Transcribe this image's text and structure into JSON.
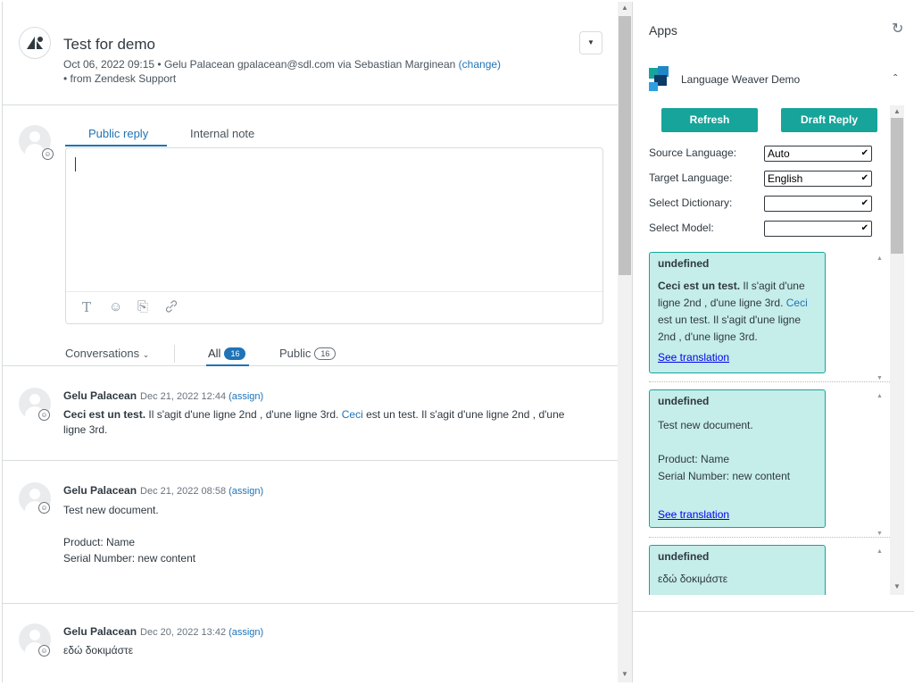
{
  "ticket": {
    "title": "Test for demo",
    "meta_line1_prefix": "Oct 06, 2022 09:15 • Gelu Palacean   gpalacean@sdl.com via Sebastian Marginean ",
    "meta_change": "(change)",
    "meta_line2": "• from Zendesk Support"
  },
  "composer": {
    "tab_public": "Public reply",
    "tab_internal": "Internal note",
    "tools": {
      "text": "T",
      "emoji": "☺",
      "attach": "⎘",
      "link": "🔗"
    }
  },
  "filters": {
    "conversations": "Conversations",
    "all": "All",
    "all_count": "16",
    "public": "Public",
    "public_count": "16"
  },
  "messages": [
    {
      "author": "Gelu Palacean",
      "date": "Dec 21, 2022 12:44",
      "assign": "(assign)",
      "body_bold": "Ceci est un test.",
      "body_rest": "  Il s'agit d'une ligne 2nd , d'une ligne 3rd. ",
      "body_link": "Ceci",
      "body_tail": " est un test. Il s'agit d'une ligne 2nd , d'une ligne 3rd."
    },
    {
      "author": "Gelu Palacean",
      "date": "Dec 21, 2022 08:58",
      "assign": "(assign)",
      "body": "Test new document.\n\nProduct: Name\nSerial Number: new content"
    },
    {
      "author": "Gelu Palacean",
      "date": "Dec 20, 2022 13:42",
      "assign": "(assign)",
      "body": "εδώ δοκιμάστε"
    }
  ],
  "apps": {
    "title": "Apps",
    "app_name": "Language Weaver Demo",
    "refresh_button": "Refresh",
    "draft_button": "Draft Reply",
    "source_label": "Source Language:",
    "source_value": "Auto",
    "target_label": "Target Language:",
    "target_value": "English",
    "dictionary_label": "Select Dictionary:",
    "dictionary_value": "",
    "model_label": "Select Model:",
    "model_value": "",
    "brand_color": "#17a49a",
    "cards": [
      {
        "title": "undefined",
        "body_bold": "Ceci est un test.",
        "body_rest": "  Il s'agit d'une ligne 2nd , d'une ligne 3rd. ",
        "body_link": "Ceci",
        "body_tail": " est un test. Il s'agit d'une ligne 2nd , d'une ligne 3rd.",
        "link": "See translation"
      },
      {
        "title": "undefined",
        "body": "Test new document.\n\nProduct: Name\nSerial Number: new content",
        "link": "See translation"
      },
      {
        "title": "undefined",
        "body": "εδώ δοκιμάστε"
      }
    ]
  }
}
